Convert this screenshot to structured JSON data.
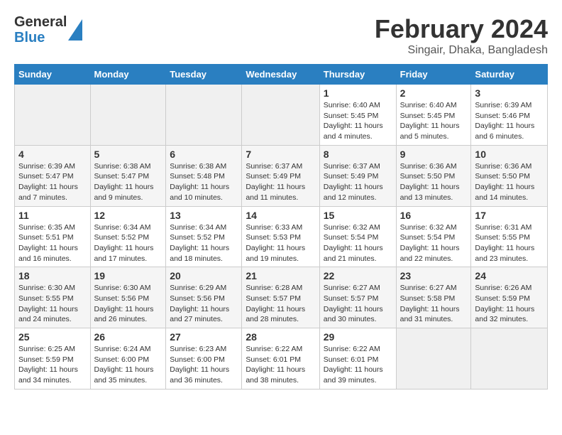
{
  "header": {
    "logo_general": "General",
    "logo_blue": "Blue",
    "title": "February 2024",
    "subtitle": "Singair, Dhaka, Bangladesh"
  },
  "days_of_week": [
    "Sunday",
    "Monday",
    "Tuesday",
    "Wednesday",
    "Thursday",
    "Friday",
    "Saturday"
  ],
  "weeks": [
    [
      {
        "day": "",
        "sunrise": "",
        "sunset": "",
        "daylight": "",
        "empty": true
      },
      {
        "day": "",
        "sunrise": "",
        "sunset": "",
        "daylight": "",
        "empty": true
      },
      {
        "day": "",
        "sunrise": "",
        "sunset": "",
        "daylight": "",
        "empty": true
      },
      {
        "day": "",
        "sunrise": "",
        "sunset": "",
        "daylight": "",
        "empty": true
      },
      {
        "day": "1",
        "sunrise": "Sunrise: 6:40 AM",
        "sunset": "Sunset: 5:45 PM",
        "daylight": "Daylight: 11 hours and 4 minutes.",
        "empty": false
      },
      {
        "day": "2",
        "sunrise": "Sunrise: 6:40 AM",
        "sunset": "Sunset: 5:45 PM",
        "daylight": "Daylight: 11 hours and 5 minutes.",
        "empty": false
      },
      {
        "day": "3",
        "sunrise": "Sunrise: 6:39 AM",
        "sunset": "Sunset: 5:46 PM",
        "daylight": "Daylight: 11 hours and 6 minutes.",
        "empty": false
      }
    ],
    [
      {
        "day": "4",
        "sunrise": "Sunrise: 6:39 AM",
        "sunset": "Sunset: 5:47 PM",
        "daylight": "Daylight: 11 hours and 7 minutes.",
        "empty": false
      },
      {
        "day": "5",
        "sunrise": "Sunrise: 6:38 AM",
        "sunset": "Sunset: 5:47 PM",
        "daylight": "Daylight: 11 hours and 9 minutes.",
        "empty": false
      },
      {
        "day": "6",
        "sunrise": "Sunrise: 6:38 AM",
        "sunset": "Sunset: 5:48 PM",
        "daylight": "Daylight: 11 hours and 10 minutes.",
        "empty": false
      },
      {
        "day": "7",
        "sunrise": "Sunrise: 6:37 AM",
        "sunset": "Sunset: 5:49 PM",
        "daylight": "Daylight: 11 hours and 11 minutes.",
        "empty": false
      },
      {
        "day": "8",
        "sunrise": "Sunrise: 6:37 AM",
        "sunset": "Sunset: 5:49 PM",
        "daylight": "Daylight: 11 hours and 12 minutes.",
        "empty": false
      },
      {
        "day": "9",
        "sunrise": "Sunrise: 6:36 AM",
        "sunset": "Sunset: 5:50 PM",
        "daylight": "Daylight: 11 hours and 13 minutes.",
        "empty": false
      },
      {
        "day": "10",
        "sunrise": "Sunrise: 6:36 AM",
        "sunset": "Sunset: 5:50 PM",
        "daylight": "Daylight: 11 hours and 14 minutes.",
        "empty": false
      }
    ],
    [
      {
        "day": "11",
        "sunrise": "Sunrise: 6:35 AM",
        "sunset": "Sunset: 5:51 PM",
        "daylight": "Daylight: 11 hours and 16 minutes.",
        "empty": false
      },
      {
        "day": "12",
        "sunrise": "Sunrise: 6:34 AM",
        "sunset": "Sunset: 5:52 PM",
        "daylight": "Daylight: 11 hours and 17 minutes.",
        "empty": false
      },
      {
        "day": "13",
        "sunrise": "Sunrise: 6:34 AM",
        "sunset": "Sunset: 5:52 PM",
        "daylight": "Daylight: 11 hours and 18 minutes.",
        "empty": false
      },
      {
        "day": "14",
        "sunrise": "Sunrise: 6:33 AM",
        "sunset": "Sunset: 5:53 PM",
        "daylight": "Daylight: 11 hours and 19 minutes.",
        "empty": false
      },
      {
        "day": "15",
        "sunrise": "Sunrise: 6:32 AM",
        "sunset": "Sunset: 5:54 PM",
        "daylight": "Daylight: 11 hours and 21 minutes.",
        "empty": false
      },
      {
        "day": "16",
        "sunrise": "Sunrise: 6:32 AM",
        "sunset": "Sunset: 5:54 PM",
        "daylight": "Daylight: 11 hours and 22 minutes.",
        "empty": false
      },
      {
        "day": "17",
        "sunrise": "Sunrise: 6:31 AM",
        "sunset": "Sunset: 5:55 PM",
        "daylight": "Daylight: 11 hours and 23 minutes.",
        "empty": false
      }
    ],
    [
      {
        "day": "18",
        "sunrise": "Sunrise: 6:30 AM",
        "sunset": "Sunset: 5:55 PM",
        "daylight": "Daylight: 11 hours and 24 minutes.",
        "empty": false
      },
      {
        "day": "19",
        "sunrise": "Sunrise: 6:30 AM",
        "sunset": "Sunset: 5:56 PM",
        "daylight": "Daylight: 11 hours and 26 minutes.",
        "empty": false
      },
      {
        "day": "20",
        "sunrise": "Sunrise: 6:29 AM",
        "sunset": "Sunset: 5:56 PM",
        "daylight": "Daylight: 11 hours and 27 minutes.",
        "empty": false
      },
      {
        "day": "21",
        "sunrise": "Sunrise: 6:28 AM",
        "sunset": "Sunset: 5:57 PM",
        "daylight": "Daylight: 11 hours and 28 minutes.",
        "empty": false
      },
      {
        "day": "22",
        "sunrise": "Sunrise: 6:27 AM",
        "sunset": "Sunset: 5:57 PM",
        "daylight": "Daylight: 11 hours and 30 minutes.",
        "empty": false
      },
      {
        "day": "23",
        "sunrise": "Sunrise: 6:27 AM",
        "sunset": "Sunset: 5:58 PM",
        "daylight": "Daylight: 11 hours and 31 minutes.",
        "empty": false
      },
      {
        "day": "24",
        "sunrise": "Sunrise: 6:26 AM",
        "sunset": "Sunset: 5:59 PM",
        "daylight": "Daylight: 11 hours and 32 minutes.",
        "empty": false
      }
    ],
    [
      {
        "day": "25",
        "sunrise": "Sunrise: 6:25 AM",
        "sunset": "Sunset: 5:59 PM",
        "daylight": "Daylight: 11 hours and 34 minutes.",
        "empty": false
      },
      {
        "day": "26",
        "sunrise": "Sunrise: 6:24 AM",
        "sunset": "Sunset: 6:00 PM",
        "daylight": "Daylight: 11 hours and 35 minutes.",
        "empty": false
      },
      {
        "day": "27",
        "sunrise": "Sunrise: 6:23 AM",
        "sunset": "Sunset: 6:00 PM",
        "daylight": "Daylight: 11 hours and 36 minutes.",
        "empty": false
      },
      {
        "day": "28",
        "sunrise": "Sunrise: 6:22 AM",
        "sunset": "Sunset: 6:01 PM",
        "daylight": "Daylight: 11 hours and 38 minutes.",
        "empty": false
      },
      {
        "day": "29",
        "sunrise": "Sunrise: 6:22 AM",
        "sunset": "Sunset: 6:01 PM",
        "daylight": "Daylight: 11 hours and 39 minutes.",
        "empty": false
      },
      {
        "day": "",
        "sunrise": "",
        "sunset": "",
        "daylight": "",
        "empty": true
      },
      {
        "day": "",
        "sunrise": "",
        "sunset": "",
        "daylight": "",
        "empty": true
      }
    ]
  ]
}
